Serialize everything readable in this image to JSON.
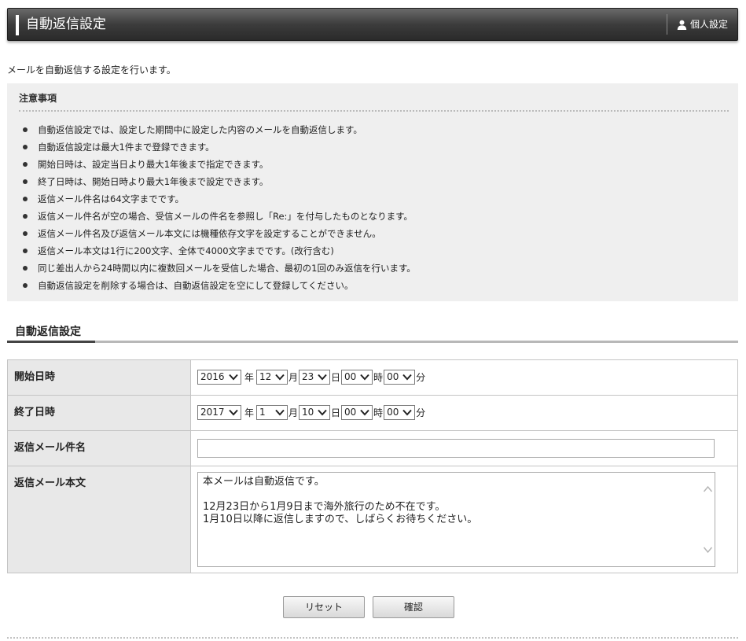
{
  "header": {
    "title": "自動返信設定",
    "personal_label": "個人設定",
    "personal_icon": "person-icon"
  },
  "intro": "メールを自動返信する設定を行います。",
  "notice": {
    "title": "注意事項",
    "items": [
      "自動返信設定では、設定した期間中に設定した内容のメールを自動返信します。",
      "自動返信設定は最大1件まで登録できます。",
      "開始日時は、設定当日より最大1年後まで指定できます。",
      "終了日時は、開始日時より最大1年後まで設定できます。",
      "返信メール件名は64文字までです。",
      "返信メール件名が空の場合、受信メールの件名を参照し「Re:」を付与したものとなります。",
      "返信メール件名及び返信メール本文には機種依存文字を設定することができません。",
      "返信メール本文は1行に200文字、全体で4000文字までです。(改行含む)",
      "同じ差出人から24時間以内に複数回メールを受信した場合、最初の1回のみ返信を行います。",
      "自動返信設定を削除する場合は、自動返信設定を空にして登録してください。"
    ]
  },
  "section_title": "自動返信設定",
  "form": {
    "start": {
      "label": "開始日時",
      "year": "2016",
      "month": "12",
      "day": "23",
      "hour": "00",
      "minute": "00"
    },
    "end": {
      "label": "終了日時",
      "year": "2017",
      "month": "1",
      "day": "10",
      "hour": "00",
      "minute": "00"
    },
    "units": {
      "year": "年",
      "month": "月",
      "day": "日",
      "hour": "時",
      "minute": "分"
    },
    "subject": {
      "label": "返信メール件名",
      "value": ""
    },
    "body": {
      "label": "返信メール本文",
      "value": "本メールは自動返信です。\n\n12月23日から1月9日まで海外旅行のため不在です。\n1月10日以降に返信しますので、しばらくお待ちください。"
    }
  },
  "buttons": {
    "reset": "リセット",
    "confirm": "確認"
  }
}
